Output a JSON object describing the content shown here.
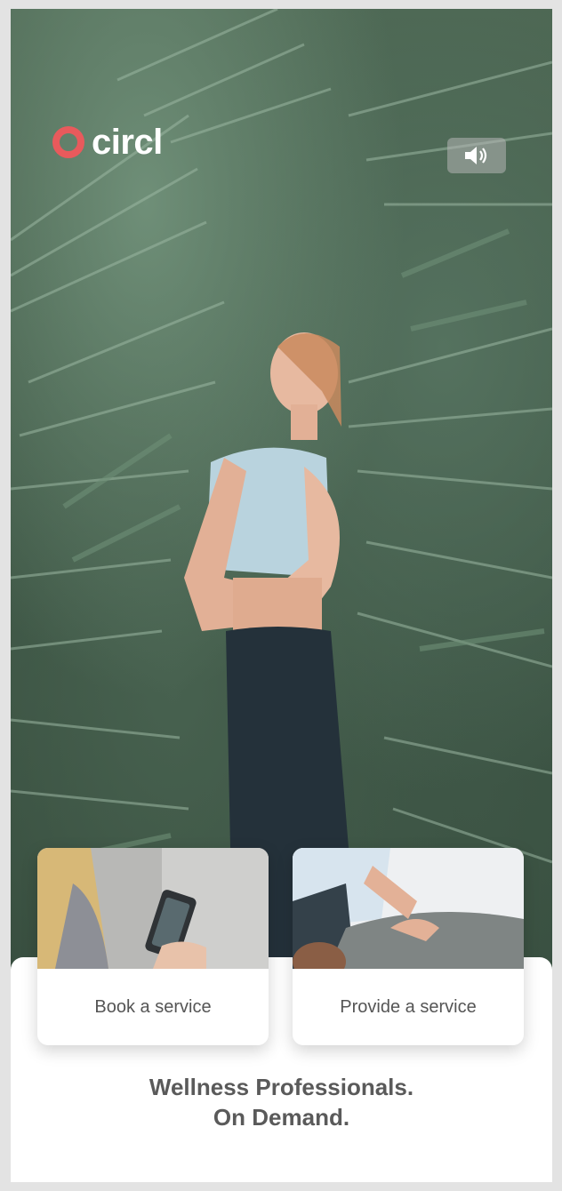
{
  "brand": {
    "name": "circl",
    "accent_color": "#e85a5c"
  },
  "header": {
    "sound_icon": "speaker-volume-icon"
  },
  "hero": {
    "image": "woman-smiling-among-palm-leaves"
  },
  "actions": [
    {
      "label": "Book a service",
      "image": "person-holding-phone"
    },
    {
      "label": "Provide a service",
      "image": "therapist-massaging-back"
    }
  ],
  "tagline": {
    "line1": "Wellness Professionals.",
    "line2": "On Demand."
  }
}
